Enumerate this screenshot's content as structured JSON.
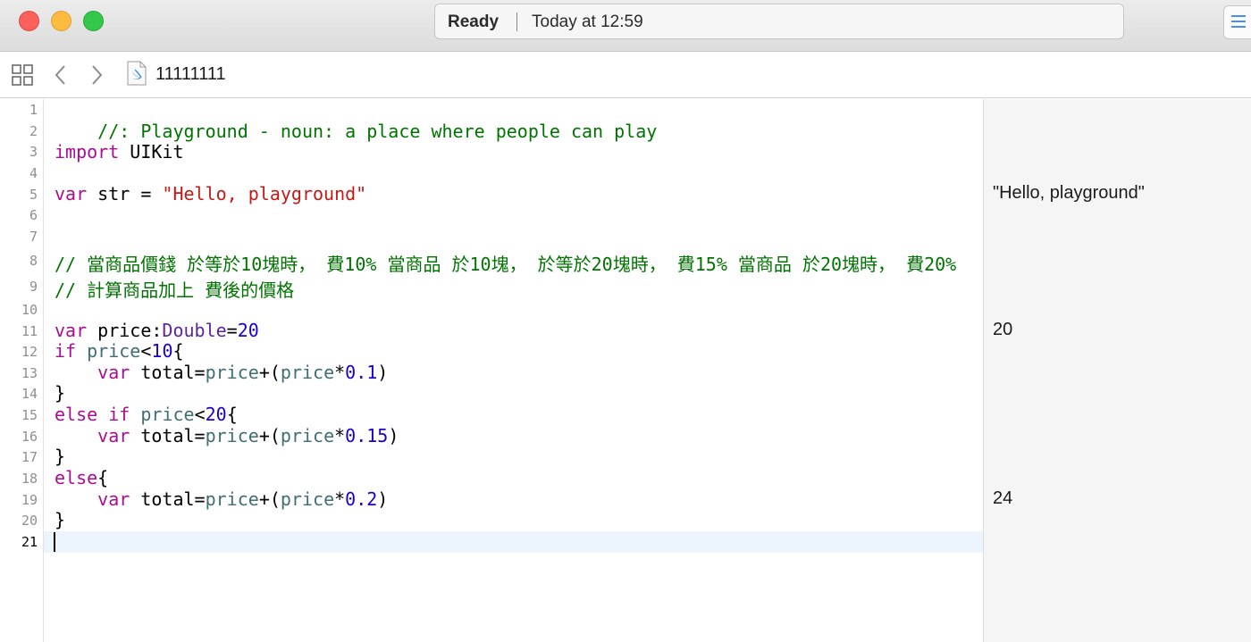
{
  "window": {
    "status": "Ready",
    "timestamp": "Today at 12:59"
  },
  "jumpbar": {
    "file_name": "11111111",
    "icons": [
      "related-items-icon",
      "back-arrow-icon",
      "forward-arrow-icon",
      "swift-file-icon"
    ]
  },
  "editor": {
    "current_line": 21,
    "line_numbers": [
      "1",
      "2",
      "3",
      "4",
      "5",
      "6",
      "7",
      "8",
      "9",
      "10",
      "11",
      "12",
      "13",
      "14",
      "15",
      "16",
      "17",
      "18",
      "19",
      "20",
      "21"
    ],
    "lines": {
      "l1": {
        "t1": "//: Playground - noun: a place where people can play"
      },
      "l3": {
        "t1": "import",
        "t2": " UIKit"
      },
      "l5": {
        "t1": "var",
        "t2": " str = ",
        "t3": "\"Hello, playground\""
      },
      "l8": {
        "t1": "// 當商品價錢 於等於10塊時， 費10% 當商品 於10塊， 於等於20塊時， 費15% 當商品 於20塊時， 費20%"
      },
      "l9": {
        "t1": "// 計算商品加上 費後的價格"
      },
      "l11": {
        "t1": "var",
        "t2": " price:",
        "t3": "Double",
        "t4": "=",
        "t5": "20"
      },
      "l12": {
        "t1": "if",
        "t2": " ",
        "t3": "price",
        "t4": "<",
        "t5": "10",
        "t6": "{"
      },
      "l13": {
        "t1": "    ",
        "t2": "var",
        "t3": " total=",
        "t4": "price",
        "t5": "+(",
        "t6": "price",
        "t7": "*",
        "t8": "0.1",
        "t9": ")"
      },
      "l14": {
        "t1": "}"
      },
      "l15": {
        "t1": "else",
        "t2": " ",
        "t3": "if",
        "t4": " ",
        "t5": "price",
        "t6": "<",
        "t7": "20",
        "t8": "{"
      },
      "l16": {
        "t1": "    ",
        "t2": "var",
        "t3": " total=",
        "t4": "price",
        "t5": "+(",
        "t6": "price",
        "t7": "*",
        "t8": "0.15",
        "t9": ")"
      },
      "l17": {
        "t1": "}"
      },
      "l18": {
        "t1": "else",
        "t2": "{"
      },
      "l19": {
        "t1": "    ",
        "t2": "var",
        "t3": " total=",
        "t4": "price",
        "t5": "+(",
        "t6": "price",
        "t7": "*",
        "t8": "0.2",
        "t9": ")"
      },
      "l20": {
        "t1": "}"
      }
    }
  },
  "results_sidebar": {
    "r5": "\"Hello, playground\"",
    "r11": "20",
    "r19": "24"
  },
  "colors": {
    "keyword": "#aa0d91",
    "string": "#c41a16",
    "number": "#1c00cf",
    "comment": "#007400",
    "type": "#5c2699",
    "project_identifier": "#3f6e74",
    "current_line_highlight": "#ecf5fe"
  }
}
